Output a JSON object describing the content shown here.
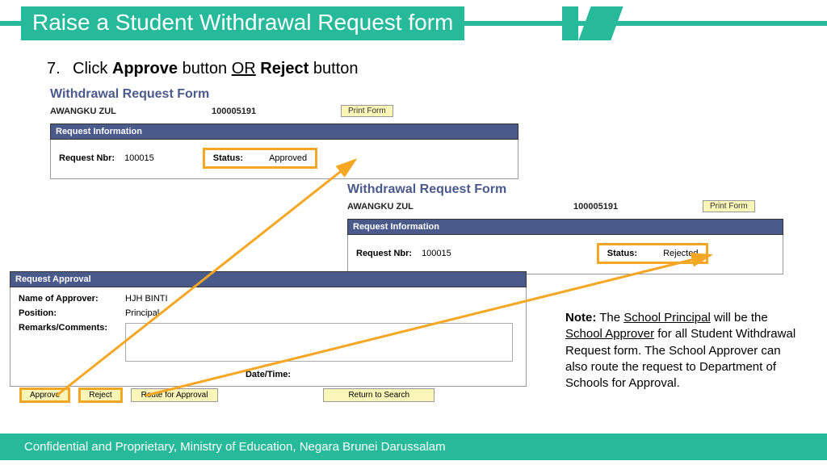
{
  "header": {
    "title": "Raise a Student Withdrawal Request form"
  },
  "step": {
    "num": "7.",
    "text_pre": "Click ",
    "b1": "Approve",
    "mid": " button ",
    "or": "OR",
    "b2": " Reject",
    "text_post": " button"
  },
  "form1": {
    "title": "Withdrawal Request Form",
    "name": "AWANGKU ZUL",
    "id": "100005191",
    "print": "Print Form",
    "sect": "Request Information",
    "req_lbl": "Request Nbr:",
    "req_val": "100015",
    "status_lbl": "Status:",
    "status_val": "Approved"
  },
  "form2": {
    "title": "Withdrawal Request Form",
    "name": "AWANGKU ZUL",
    "id": "100005191",
    "print": "Print Form",
    "sect": "Request Information",
    "req_lbl": "Request Nbr:",
    "req_val": "100015",
    "status_lbl": "Status:",
    "status_val": "Rejected"
  },
  "form3": {
    "sect": "Request Approval",
    "appr_lbl": "Name of Approver:",
    "appr_val": "HJH BINTI",
    "pos_lbl": "Position:",
    "pos_val": "Principal",
    "rem_lbl": "Remarks/Comments:",
    "dt_lbl": "Date/Time:"
  },
  "buttons": {
    "approve": "Approve",
    "reject": "Reject",
    "route": "Route for Approval",
    "return": "Return to Search"
  },
  "note": {
    "lead": "Note:",
    "t1": " The ",
    "u1": "School Principal",
    "t2": " will be the ",
    "u2": "School Approver",
    "t3": " for all Student Withdrawal Request form. The School Approver can also route the request to Department of Schools for Approval."
  },
  "footer": "Confidential and Proprietary, Ministry of Education, Negara Brunei Darussalam"
}
